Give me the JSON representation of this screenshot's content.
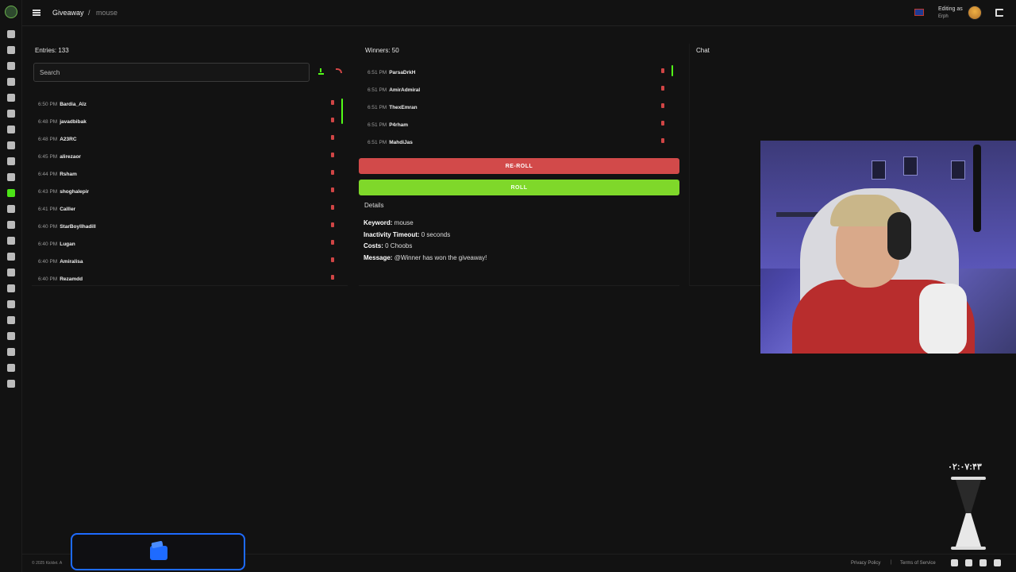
{
  "header": {
    "breadcrumb_root": "Giveaway",
    "breadcrumb_separator": "/",
    "breadcrumb_current": "mouse",
    "editing_label": "Editing as",
    "editing_user": "Erph"
  },
  "sidebar": {
    "icons": [
      "dashboard-icon",
      "document-icon",
      "tool-icon",
      "hammer-icon",
      "chat-icon",
      "clock-icon",
      "shield-icon",
      "alert-icon",
      "music-icon",
      "star-icon",
      "gift-icon",
      "cart-icon",
      "link-icon",
      "chart-icon",
      "video-icon",
      "box-icon",
      "emoji-icon",
      "film-icon",
      "message-icon",
      "monitor-icon",
      "search-icon",
      "discord-icon",
      "card-icon"
    ],
    "active": "gift-icon",
    "accent": "#53fc18"
  },
  "entries": {
    "title": "Entries: 133",
    "search_placeholder": "Search",
    "rows": [
      {
        "time": "6:50 PM",
        "name": "Bardia_Alz"
      },
      {
        "time": "6:48 PM",
        "name": "javadbibak"
      },
      {
        "time": "6:48 PM",
        "name": "A23RC"
      },
      {
        "time": "6:45 PM",
        "name": "alirezaor"
      },
      {
        "time": "6:44 PM",
        "name": "Rsham"
      },
      {
        "time": "6:43 PM",
        "name": "shoghalepir"
      },
      {
        "time": "6:41 PM",
        "name": "Calller"
      },
      {
        "time": "6:40 PM",
        "name": "StarBoyIlhadill"
      },
      {
        "time": "6:40 PM",
        "name": "Lugan"
      },
      {
        "time": "6:40 PM",
        "name": "Amiralisa"
      },
      {
        "time": "6:40 PM",
        "name": "Rezamdd"
      }
    ]
  },
  "winners": {
    "title": "Winners: 50",
    "rows": [
      {
        "time": "6:51 PM",
        "name": "ParsaDrkH"
      },
      {
        "time": "6:51 PM",
        "name": "AmirAdmiral"
      },
      {
        "time": "6:51 PM",
        "name": "ThexEmran"
      },
      {
        "time": "6:51 PM",
        "name": "P4rham"
      },
      {
        "time": "6:51 PM",
        "name": "MahdiJas"
      }
    ],
    "reroll_label": "RE-ROLL",
    "roll_label": "ROLL"
  },
  "details": {
    "title": "Details",
    "keyword_label": "Keyword:",
    "keyword_value": " mouse",
    "inactivity_label": "Inactivity Timeout:",
    "inactivity_value": " 0 seconds",
    "costs_label": "Costs:",
    "costs_value": " 0 Choobs",
    "message_label": "Message:",
    "message_value": " @Winner has won the giveaway!"
  },
  "chat": {
    "title": "Chat"
  },
  "overlay": {
    "clock": "۰۲:۰۷:۴۳"
  },
  "footer": {
    "copyright": "© 2025 Kicklet. A",
    "privacy": "Privacy Policy",
    "separator": "|",
    "terms": "Terms of Service",
    "socials": [
      "discord-icon",
      "kick-icon",
      "x-icon",
      "docs-icon"
    ]
  },
  "colors": {
    "background": "#121212",
    "reroll": "#d24a4a",
    "roll": "#7fd82a",
    "wallet_border": "#1e6bff"
  }
}
